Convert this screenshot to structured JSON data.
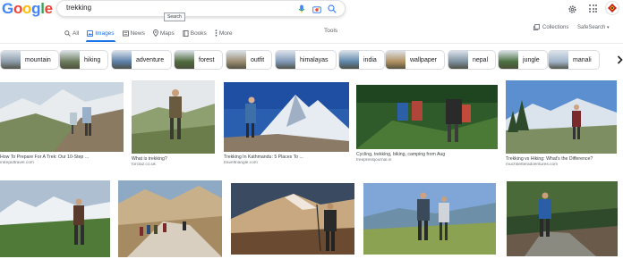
{
  "logo": {
    "letters": [
      "G",
      "o",
      "o",
      "g",
      "l",
      "e"
    ],
    "colors": [
      "#4285f4",
      "#ea4335",
      "#fbbc05",
      "#4285f4",
      "#34a853",
      "#ea4335"
    ]
  },
  "search": {
    "query": "trekking",
    "tooltip": "Search"
  },
  "header_icons": [
    "mic-icon",
    "camera-icon",
    "search-icon",
    "gear-icon",
    "apps-icon",
    "avatar"
  ],
  "tabs": [
    {
      "label": "All",
      "icon": "search-icon"
    },
    {
      "label": "Images",
      "icon": "image-icon",
      "active": true
    },
    {
      "label": "News",
      "icon": "news-icon"
    },
    {
      "label": "Maps",
      "icon": "pin-icon"
    },
    {
      "label": "Books",
      "icon": "book-icon"
    },
    {
      "label": "More",
      "icon": "more-icon"
    }
  ],
  "tools_label": "Tools",
  "collections_label": "Collections",
  "safesearch_label": "SafeSearch",
  "chips": [
    {
      "label": "mountain",
      "color": "#8a9aa8"
    },
    {
      "label": "hiking",
      "color": "#6b7b5a"
    },
    {
      "label": "adventure",
      "color": "#5a7fa8"
    },
    {
      "label": "forest",
      "color": "#4f6a3c"
    },
    {
      "label": "outfit",
      "color": "#9a8b70"
    },
    {
      "label": "himalayas",
      "color": "#7f97b5"
    },
    {
      "label": "india",
      "color": "#5d86a8"
    },
    {
      "label": "wallpaper",
      "color": "#b09060"
    },
    {
      "label": "nepal",
      "color": "#7c8f9e"
    },
    {
      "label": "jungle",
      "color": "#4a7040"
    },
    {
      "label": "manali",
      "color": "#a0b4c8"
    }
  ],
  "results_row1": [
    {
      "title": "How To Prepare For A Trek: Our 10-Step ...",
      "source": "intrepidtravel.com"
    },
    {
      "title": "What is trekking?",
      "source": "forclaz.co.uk"
    },
    {
      "title": "Trekking In Kathmandu: 5 Places To ...",
      "source": "traveltriangle.com"
    },
    {
      "title": "Cycling, trekking, biking, camping from Aug",
      "source": "freepressjournal.in"
    },
    {
      "title": "Trekking vs Hiking: What's the Difference?",
      "source": "muchbetteradventures.com"
    }
  ],
  "results_row2": [
    {
      "title": ""
    },
    {
      "title": ""
    },
    {
      "title": ""
    },
    {
      "title": ""
    },
    {
      "title": ""
    }
  ]
}
